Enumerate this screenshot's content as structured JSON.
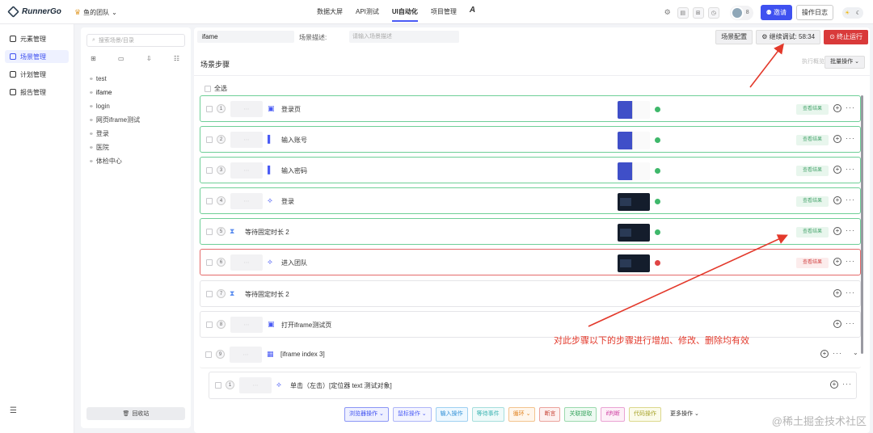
{
  "app": {
    "name": "RunnerGo",
    "team": "鱼的团队"
  },
  "nav": [
    "数据大屏",
    "API测试",
    "UI自动化",
    "项目管理"
  ],
  "nav_active": "UI自动化",
  "header": {
    "member_count": "8",
    "invite": "邀请",
    "log": "操作日志"
  },
  "sidebar": [
    "元素管理",
    "场景管理",
    "计划管理",
    "报告管理"
  ],
  "tree": {
    "search_placeholder": "搜索场景/目录",
    "nodes": [
      "test",
      "ifame",
      "login",
      "网页iframe测试",
      "登录",
      "医院",
      "体检中心"
    ],
    "recycle": "回收站"
  },
  "main": {
    "name": "ifame",
    "desc_label": "场景描述:",
    "desc_placeholder": "请输入场景描述",
    "btn_config": "场景配置",
    "btn_continue": "继续调试: 58:34",
    "btn_stop": "终止运行",
    "steps_title": "场景步骤",
    "exec_label": "执行概览",
    "batch": "批量操作",
    "select_all": "全选",
    "view_result": "查看结果"
  },
  "steps": [
    {
      "num": "1",
      "label": "登录页"
    },
    {
      "num": "2",
      "label": "输入账号"
    },
    {
      "num": "3",
      "label": "输入密码"
    },
    {
      "num": "4",
      "label": "登录"
    },
    {
      "num": "5",
      "label": "等待固定时长 2"
    },
    {
      "num": "6",
      "label": "进入团队"
    },
    {
      "num": "7",
      "label": "等待固定时长 2"
    },
    {
      "num": "8",
      "label": "打开iframe测试页"
    },
    {
      "num": "9",
      "label": "[iframe index 3]"
    }
  ],
  "sub_step": {
    "num": "1",
    "label": "单击（左击）[定位器 text 测试对象]"
  },
  "ops": [
    "浏览器操作",
    "鼠标操作",
    "输入操作",
    "等待事件",
    "循环",
    "断言",
    "关联提取",
    "if判断",
    "代码操作",
    "更多操作"
  ],
  "annotation": "对此步骤以下的步骤进行增加、修改、删除均有效",
  "watermark": "@稀土掘金技术社区",
  "colors": {
    "accent": "#3f51f0",
    "success": "#3fb86b",
    "danger": "#d93a3a",
    "annotation": "#e3392b"
  }
}
